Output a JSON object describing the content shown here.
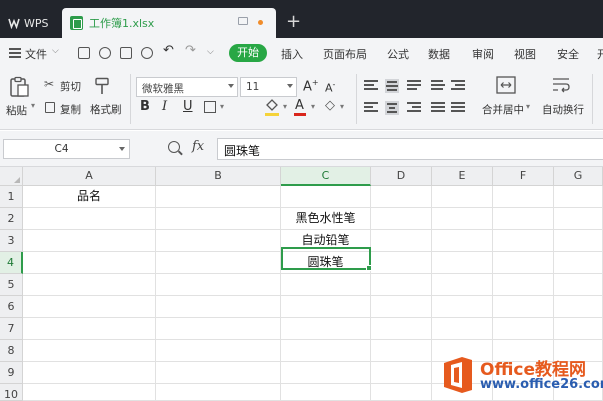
{
  "app": {
    "wps_tab": "WPS",
    "document_tab": "工作簿1.xlsx",
    "new_tab": "+"
  },
  "menu": {
    "file": "文件",
    "start": "开始",
    "items": [
      "插入",
      "页面布局",
      "公式",
      "数据",
      "审阅",
      "视图",
      "安全",
      "开"
    ]
  },
  "ribbon": {
    "paste": "粘贴",
    "cut": "剪切",
    "copy": "复制",
    "format_painter": "格式刷",
    "font_name": "微软雅黑",
    "font_size": "11",
    "merge_center": "合并居中",
    "wrap_text": "自动换行",
    "bold": "B",
    "italic": "I",
    "underline": "U",
    "font_color_glyph": "A",
    "font_color": "#d9261c",
    "fill_color": "#f5d33a"
  },
  "formula_bar": {
    "name_box": "C4",
    "fx": "fx",
    "value": "圆珠笔"
  },
  "sheet": {
    "columns": [
      "A",
      "B",
      "C",
      "D",
      "E",
      "F",
      "G"
    ],
    "rows": [
      "1",
      "2",
      "3",
      "4",
      "5",
      "6",
      "7",
      "8",
      "9",
      "10"
    ],
    "selected_column": "C",
    "selected_row": "4",
    "cells": {
      "A1": "品名",
      "C2": "黑色水性笔",
      "C3": "自动铅笔",
      "C4": "圆珠笔"
    },
    "accent_color": "#2e9c4b"
  },
  "watermark": {
    "title": "Office教程网",
    "url": "www.office26.com"
  }
}
